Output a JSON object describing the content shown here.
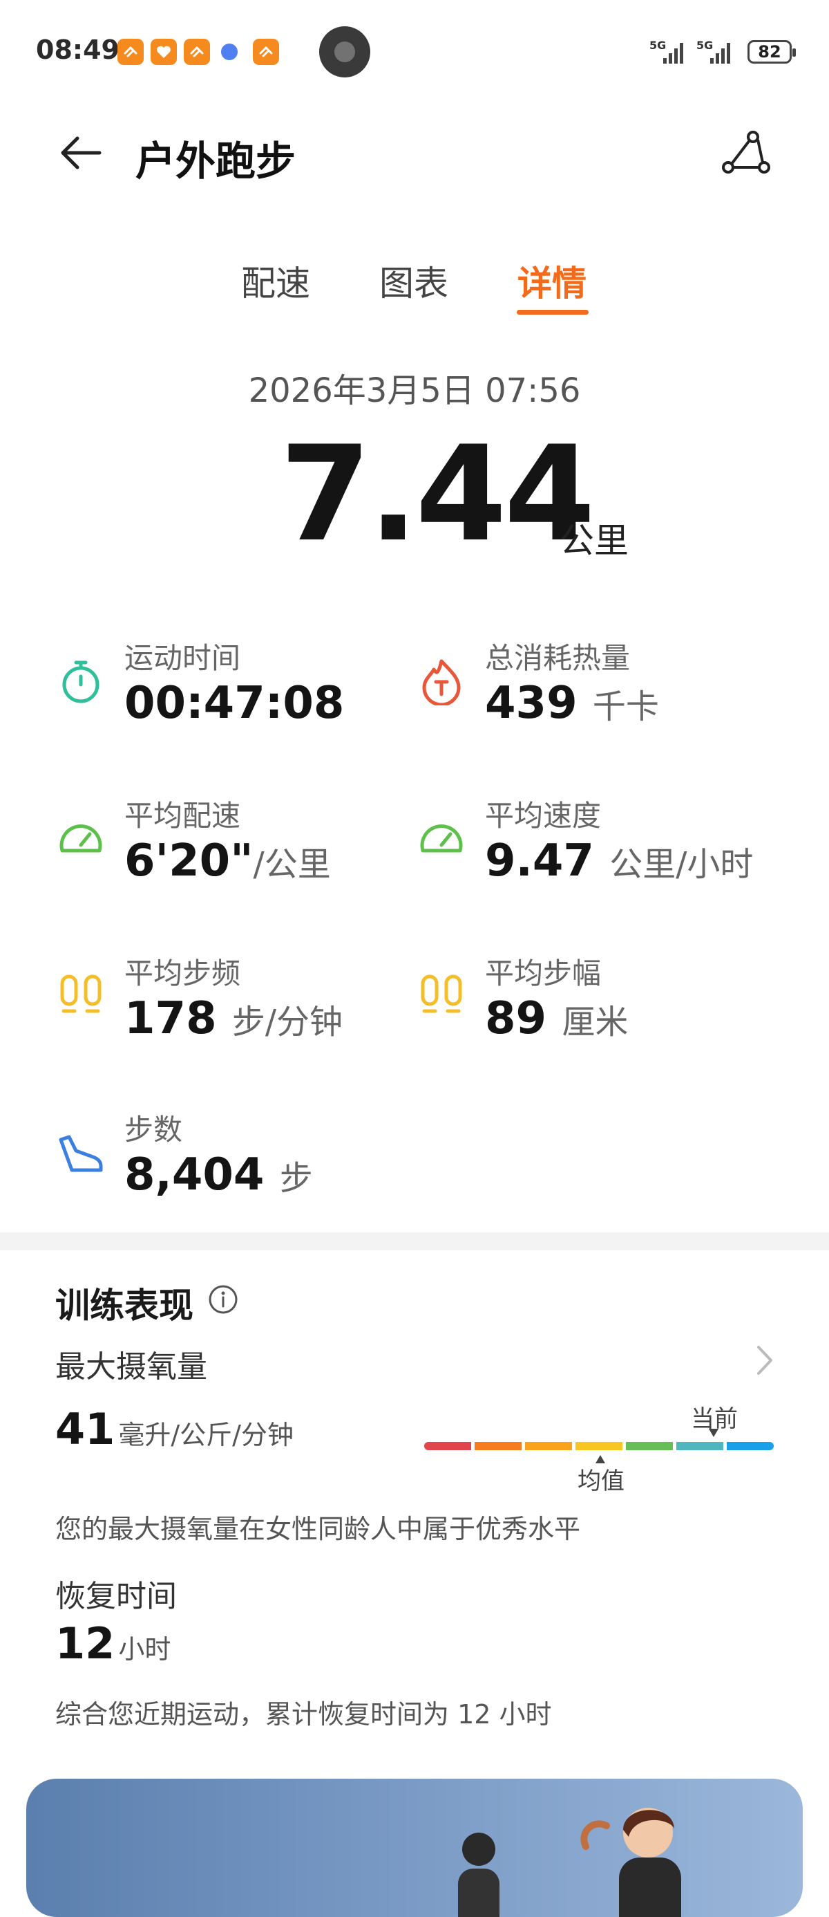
{
  "status_bar": {
    "time": "08:49",
    "network1": "5G",
    "network2": "5G",
    "battery": "82"
  },
  "header": {
    "title": "户外跑步"
  },
  "tabs": [
    {
      "label": "配速",
      "active": false
    },
    {
      "label": "图表",
      "active": false
    },
    {
      "label": "详情",
      "active": true
    }
  ],
  "summary": {
    "date": "2026年3月5日 07:56",
    "distance": "7.44",
    "distance_unit": "公里"
  },
  "metrics": {
    "duration": {
      "label": "运动时间",
      "value": "00:47:08",
      "unit": "",
      "icon": "stopwatch-icon"
    },
    "calories": {
      "label": "总消耗热量",
      "value": "439",
      "unit": "千卡",
      "icon": "flame-icon"
    },
    "avg_pace": {
      "label": "平均配速",
      "value": "6'20\"",
      "unit": "/公里",
      "icon": "speedometer-icon"
    },
    "avg_speed": {
      "label": "平均速度",
      "value": "9.47",
      "unit": "公里/小时",
      "icon": "speedometer-icon"
    },
    "cadence": {
      "label": "平均步频",
      "value": "178",
      "unit": "步/分钟",
      "icon": "footprints-icon"
    },
    "stride": {
      "label": "平均步幅",
      "value": "89",
      "unit": "厘米",
      "icon": "footprints-icon"
    },
    "steps": {
      "label": "步数",
      "value": "8,404",
      "unit": "步",
      "icon": "shoe-icon"
    }
  },
  "training": {
    "title": "训练表现",
    "vo2max": {
      "label": "最大摄氧量",
      "value": "41",
      "unit": "毫升/公斤/分钟",
      "current_label": "当前",
      "average_label": "均值",
      "description": "您的最大摄氧量在女性同龄人中属于优秀水平",
      "scale_colors": [
        "#e0454b",
        "#f57c1f",
        "#f9a21b",
        "#f7c623",
        "#67be57",
        "#4fb6bd",
        "#1aa0e8"
      ]
    },
    "recovery": {
      "label": "恢复时间",
      "value": "12",
      "unit": "小时",
      "description": "综合您近期运动，累计恢复时间为 12 小时"
    }
  },
  "colors": {
    "accent": "#f26b1d",
    "teal": "#2fbf9a",
    "orange_red": "#e8573a",
    "green": "#5cc04a",
    "yellow": "#f3be2a",
    "blue": "#3b7fe0"
  }
}
